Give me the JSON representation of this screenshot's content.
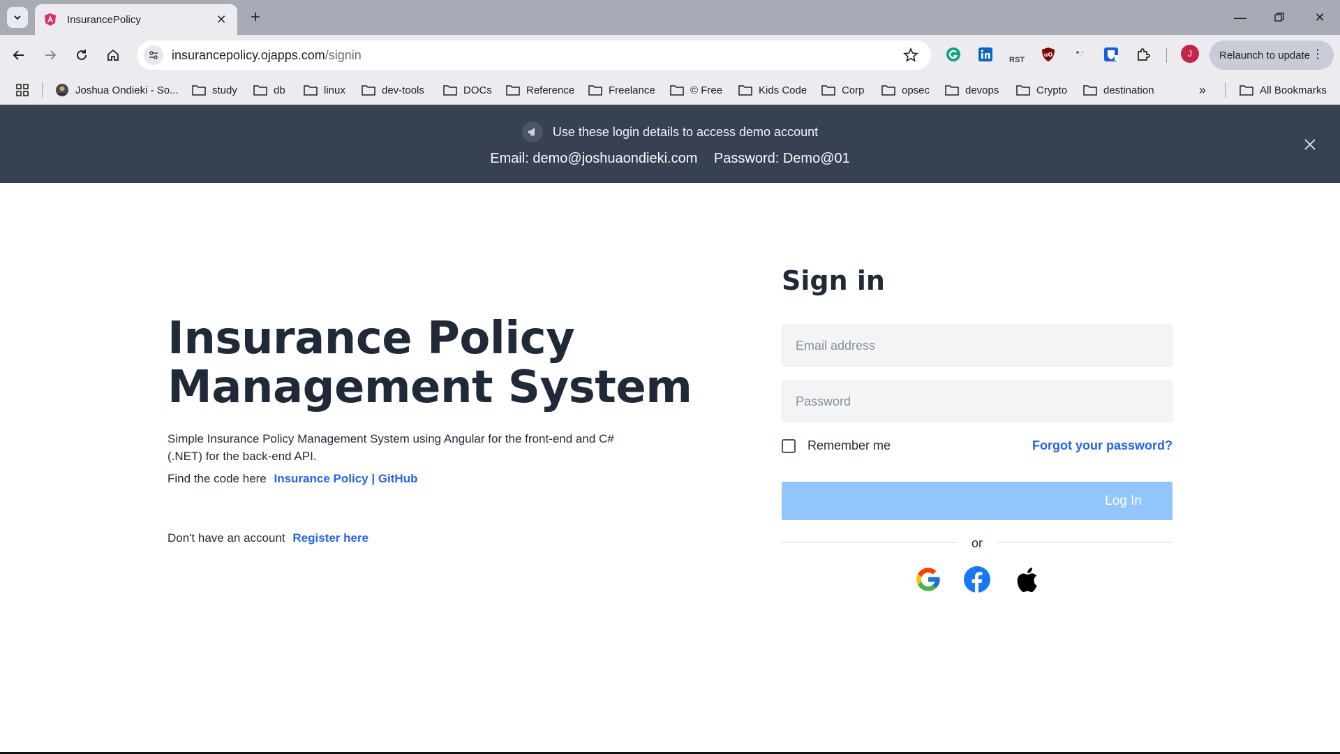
{
  "browser": {
    "tab_title": "InsurancePolicy",
    "url_host": "insurancepolicy.ojapps.com",
    "url_path": "/signin",
    "relaunch_label": "Relaunch to update",
    "profile_initial": "J",
    "extensions": [
      "grammarly-icon",
      "linkedin-icon",
      "rst-icon",
      "ublock-icon",
      "dots-extension-icon",
      "bitwarden-icon",
      "puzzle-icon"
    ],
    "ext_rst_label": "RST"
  },
  "bookmarks": {
    "items": [
      {
        "label": "Joshua Ondieki - So...",
        "icon": "avatar-icon"
      },
      {
        "label": "study",
        "icon": "folder-icon"
      },
      {
        "label": "db",
        "icon": "folder-icon"
      },
      {
        "label": "linux",
        "icon": "folder-icon"
      },
      {
        "label": "dev-tools",
        "icon": "folder-icon"
      },
      {
        "label": "DOCs",
        "icon": "folder-icon"
      },
      {
        "label": "Reference",
        "icon": "folder-icon"
      },
      {
        "label": "Freelance",
        "icon": "folder-icon"
      },
      {
        "label": "© Free",
        "icon": "folder-icon"
      },
      {
        "label": "Kids Code",
        "icon": "folder-icon"
      },
      {
        "label": "Corp",
        "icon": "folder-icon"
      },
      {
        "label": "opsec",
        "icon": "folder-icon"
      },
      {
        "label": "devops",
        "icon": "folder-icon"
      },
      {
        "label": "Crypto",
        "icon": "folder-icon"
      },
      {
        "label": "destination",
        "icon": "folder-icon"
      }
    ],
    "all_bookmarks": "All Bookmarks"
  },
  "banner": {
    "message": "Use these login details to access demo account",
    "email_text": "Email: demo@joshuaondieki.com",
    "password_text": "Password: Demo@01"
  },
  "hero": {
    "title_line1": "Insurance Policy",
    "title_line2": "Management System",
    "description": "Simple Insurance Policy Management System using Angular for the front-end and C# (.NET) for the back-end API.",
    "code_prefix": "Find the code here",
    "code_link": "Insurance Policy | GitHub",
    "register_prefix": "Don't have an account",
    "register_link": "Register here"
  },
  "signin": {
    "title": "Sign in",
    "email_placeholder": "Email address",
    "password_placeholder": "Password",
    "remember_label": "Remember me",
    "forgot_label": "Forgot your password?",
    "login_label": "Log In",
    "or_label": "or"
  },
  "colors": {
    "banner_bg": "#374151",
    "link": "#2563eb",
    "button_disabled": "#93c5fd",
    "heading": "#1f2937"
  }
}
